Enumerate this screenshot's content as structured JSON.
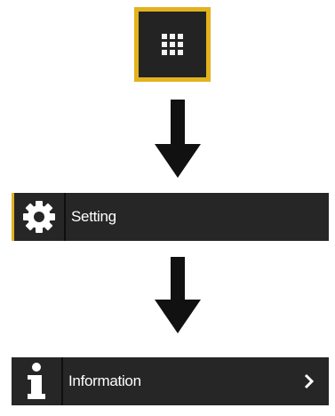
{
  "apps_button": {
    "icon": "grid-icon",
    "accent_color": "#e2b21f",
    "background_color": "#232323"
  },
  "setting_row": {
    "icon": "gear-icon",
    "label": "Setting"
  },
  "information_row": {
    "icon": "info-icon",
    "label": "Information",
    "chevron": "chevron-right-icon"
  },
  "colors": {
    "row_background": "#262626",
    "arrow": "#111111",
    "text": "#ffffff"
  }
}
